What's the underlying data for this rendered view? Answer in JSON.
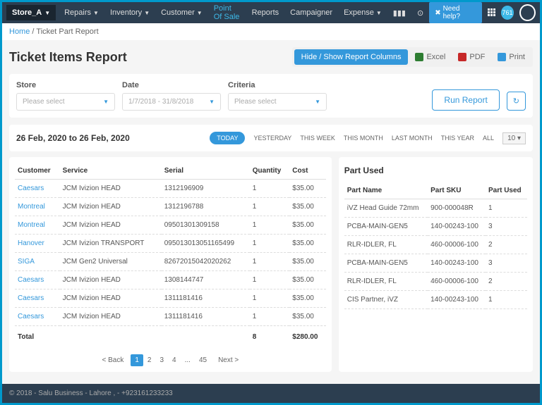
{
  "topbar": {
    "store": "Store_A",
    "nav": [
      "Repairs",
      "Inventory",
      "Customer",
      "Point Of Sale",
      "Reports",
      "Campaigner",
      "Expense"
    ],
    "help": "Need help?",
    "badge": "761"
  },
  "breadcrumb": {
    "home": "Home",
    "current": "Ticket Part Report"
  },
  "header": {
    "title": "Ticket Items Report",
    "hide_show": "Hide / Show Report Columns",
    "excel": "Excel",
    "pdf": "PDF",
    "print": "Print"
  },
  "filters": {
    "store_lbl": "Store",
    "store_ph": "Please select",
    "date_lbl": "Date",
    "date_ph": "1/7/2018 - 31/8/2018",
    "criteria_lbl": "Criteria",
    "criteria_ph": "Please select",
    "run": "Run Report"
  },
  "range": {
    "text": "26 Feb, 2020 to 26 Feb, 2020",
    "today": "TODAY",
    "tabs": [
      "YESTERDAY",
      "THIS WEEK",
      "THIS MONTH",
      "LAST MONTH",
      "THIS YEAR",
      "ALL"
    ],
    "rows": "10"
  },
  "items_table": {
    "cols": {
      "customer": "Customer",
      "service": "Service",
      "serial": "Serial",
      "qty": "Quantity",
      "cost": "Cost"
    },
    "rows": [
      {
        "customer": "Caesars",
        "service": "JCM Ivizion HEAD",
        "serial": "1312196909",
        "qty": "1",
        "cost": "$35.00"
      },
      {
        "customer": "Montreal",
        "service": "JCM Ivizion HEAD",
        "serial": "1312196788",
        "qty": "1",
        "cost": "$35.00"
      },
      {
        "customer": "Montreal",
        "service": "JCM Ivizion HEAD",
        "serial": "09501301309158",
        "qty": "1",
        "cost": "$35.00"
      },
      {
        "customer": "Hanover",
        "service": "JCM Ivizion TRANSPORT",
        "serial": "095013013051165499",
        "qty": "1",
        "cost": "$35.00"
      },
      {
        "customer": "SIGA",
        "service": "JCM Gen2 Universal",
        "serial": "82672015042020262",
        "qty": "1",
        "cost": "$35.00"
      },
      {
        "customer": "Caesars",
        "service": "JCM Ivizion HEAD",
        "serial": "1308144747",
        "qty": "1",
        "cost": "$35.00"
      },
      {
        "customer": "Caesars",
        "service": "JCM Ivizion HEAD",
        "serial": "1311181416",
        "qty": "1",
        "cost": "$35.00"
      },
      {
        "customer": "Caesars",
        "service": "JCM Ivizion HEAD",
        "serial": "1311181416",
        "qty": "1",
        "cost": "$35.00"
      }
    ],
    "total_lbl": "Total",
    "total_qty": "8",
    "total_cost": "$280.00"
  },
  "parts_table": {
    "title": "Part Used",
    "cols": {
      "name": "Part Name",
      "sku": "Part SKU",
      "used": "Part Used"
    },
    "rows": [
      {
        "name": "iVZ Head Guide 72mm",
        "sku": "900-000048R",
        "used": "1"
      },
      {
        "name": "PCBA-MAIN-GEN5",
        "sku": "140-00243-100",
        "used": "3"
      },
      {
        "name": "RLR-IDLER, FL",
        "sku": "460-00006-100",
        "used": "2"
      },
      {
        "name": "PCBA-MAIN-GEN5",
        "sku": "140-00243-100",
        "used": "3"
      },
      {
        "name": "RLR-IDLER, FL",
        "sku": "460-00006-100",
        "used": "2"
      },
      {
        "name": "CIS Partner, iVZ",
        "sku": "140-00243-100",
        "used": "1"
      }
    ]
  },
  "pager": {
    "back": "< Back",
    "pages": [
      "1",
      "2",
      "3",
      "4",
      "...",
      "45"
    ],
    "next": "Next >"
  },
  "footer": "© 2018 - Salu Business - Lahore , - +923161233233"
}
